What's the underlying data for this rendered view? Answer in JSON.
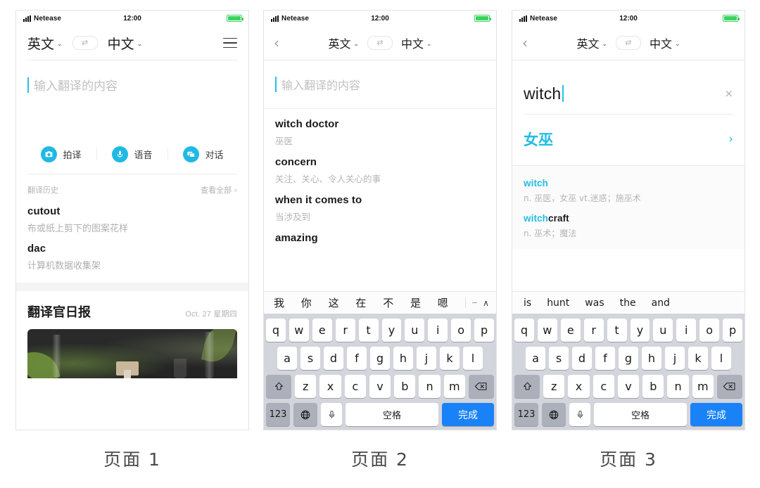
{
  "meta": {
    "accent_cyan": "#1fb9e3",
    "accent_blue": "#1a82f7",
    "battery_green": "#3ad35f",
    "keyboard_bg": "#d2d5db"
  },
  "status_bar": {
    "carrier": "Netease",
    "time": "12:00"
  },
  "captions": {
    "page1": "页面 1",
    "page2": "页面 2",
    "page3": "页面 3"
  },
  "lang_bar": {
    "source": "英文",
    "target": "中文",
    "swap_icon": "swap-icon",
    "caret": "⌄",
    "back_icon": "‹",
    "menu_icon": "hamburger-icon"
  },
  "page1": {
    "input_placeholder": "输入翻译的内容",
    "actions": [
      {
        "label": "拍译",
        "icon": "camera-icon"
      },
      {
        "label": "语音",
        "icon": "microphone-icon"
      },
      {
        "label": "对话",
        "icon": "chat-icon"
      }
    ],
    "history": {
      "title": "翻译历史",
      "view_all": "查看全部 ›",
      "items": [
        {
          "word": "cutout",
          "definition": "布或纸上剪下的图案花样"
        },
        {
          "word": "dac",
          "definition": "计算机数据收集架"
        }
      ]
    },
    "daily": {
      "title": "翻译官日报",
      "date": "Oct. 27  星期四"
    }
  },
  "page2": {
    "input_placeholder": "输入翻译的内容",
    "suggestions": [
      {
        "word": "witch doctor",
        "definition": "巫医"
      },
      {
        "word": "concern",
        "definition": "关注、关心、令人关心的事"
      },
      {
        "word": "when it comes to",
        "definition": "当涉及到"
      },
      {
        "word": "amazing",
        "definition": ""
      }
    ],
    "candidates": [
      "我",
      "你",
      "这",
      "在",
      "不",
      "是",
      "嗯"
    ],
    "candidate_sep": "−",
    "candidate_expand": "∧"
  },
  "page3": {
    "query": "witch",
    "clear_icon": "×",
    "result": {
      "translation": "女巫",
      "arrow": "›"
    },
    "dictionary": [
      {
        "highlight": "witch",
        "rest": "",
        "definition": "n. 巫医，女巫  vt.迷惑；施巫术"
      },
      {
        "highlight": "witch",
        "rest": "craft",
        "definition": "n. 巫术；魔法"
      }
    ],
    "candidates": [
      "is",
      "hunt",
      "was",
      "the",
      "and"
    ]
  },
  "keyboard": {
    "row1": [
      "q",
      "w",
      "e",
      "r",
      "t",
      "y",
      "u",
      "i",
      "o",
      "p"
    ],
    "row2": [
      "a",
      "s",
      "d",
      "f",
      "g",
      "h",
      "j",
      "k",
      "l"
    ],
    "row3": [
      "z",
      "x",
      "c",
      "v",
      "b",
      "n",
      "m"
    ],
    "shift_icon": "shift-icon",
    "backspace_icon": "backspace-icon",
    "numeric_label": "123",
    "globe_icon": "globe-icon",
    "mic_icon": "microphone-icon",
    "space_label": "空格",
    "done_label": "完成"
  }
}
